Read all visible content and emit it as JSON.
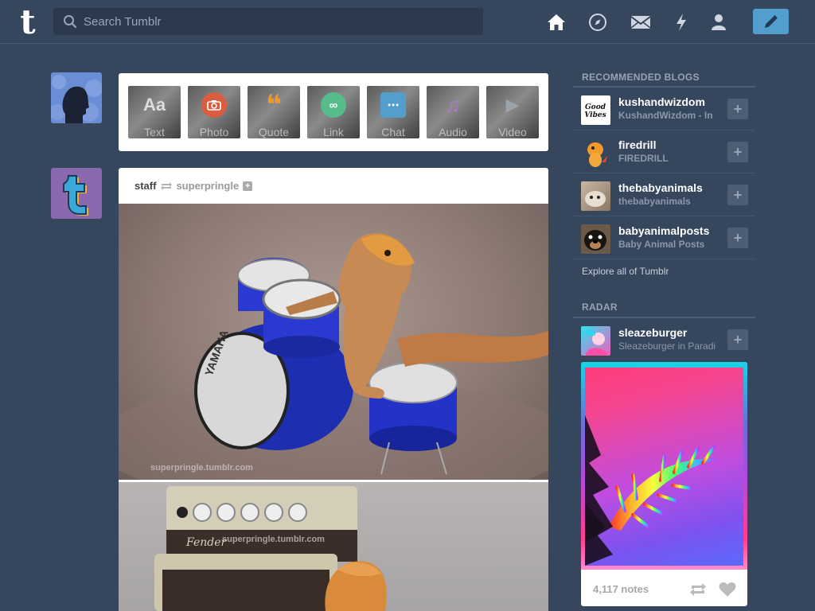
{
  "header": {
    "logo": "t",
    "search_placeholder": "Search Tumblr",
    "nav": [
      "home-icon",
      "explore-compass-icon",
      "messages-envelope-icon",
      "activity-lightning-icon",
      "account-person-icon"
    ],
    "compose_icon": "pencil-icon"
  },
  "post_types": [
    {
      "label": "Text",
      "glyph": "Aa",
      "color": "#444444"
    },
    {
      "label": "Photo",
      "glyph": "",
      "color": "#d95e40"
    },
    {
      "label": "Quote",
      "glyph": "❝",
      "color": "#f2992e"
    },
    {
      "label": "Link",
      "glyph": "∞",
      "color": "#56bc8a"
    },
    {
      "label": "Chat",
      "glyph": "⋯",
      "color": "#529ecc"
    },
    {
      "label": "Audio",
      "glyph": "♫",
      "color": "#a77dc2"
    },
    {
      "label": "Video",
      "glyph": "▶",
      "color": "#748089"
    }
  ],
  "post": {
    "author": "staff",
    "reblogged_from": "superpringle",
    "watermark": "superpringle.tumblr.com"
  },
  "recommended": {
    "title": "RECOMMENDED BLOGS",
    "blogs": [
      {
        "name": "kushandwizdom",
        "desc": "KushandWizdom - In"
      },
      {
        "name": "firedrill",
        "desc": "FIREDRILL"
      },
      {
        "name": "thebabyanimals",
        "desc": "thebabyanimals"
      },
      {
        "name": "babyanimalposts",
        "desc": "Baby Animal Posts"
      }
    ],
    "explore": "Explore all of Tumblr"
  },
  "radar": {
    "title": "RADAR",
    "name": "sleazeburger",
    "desc": "Sleazeburger in Paradi",
    "notes": "4,117 notes"
  },
  "colors": {
    "background": "#36465d",
    "accent": "#529ecc"
  }
}
